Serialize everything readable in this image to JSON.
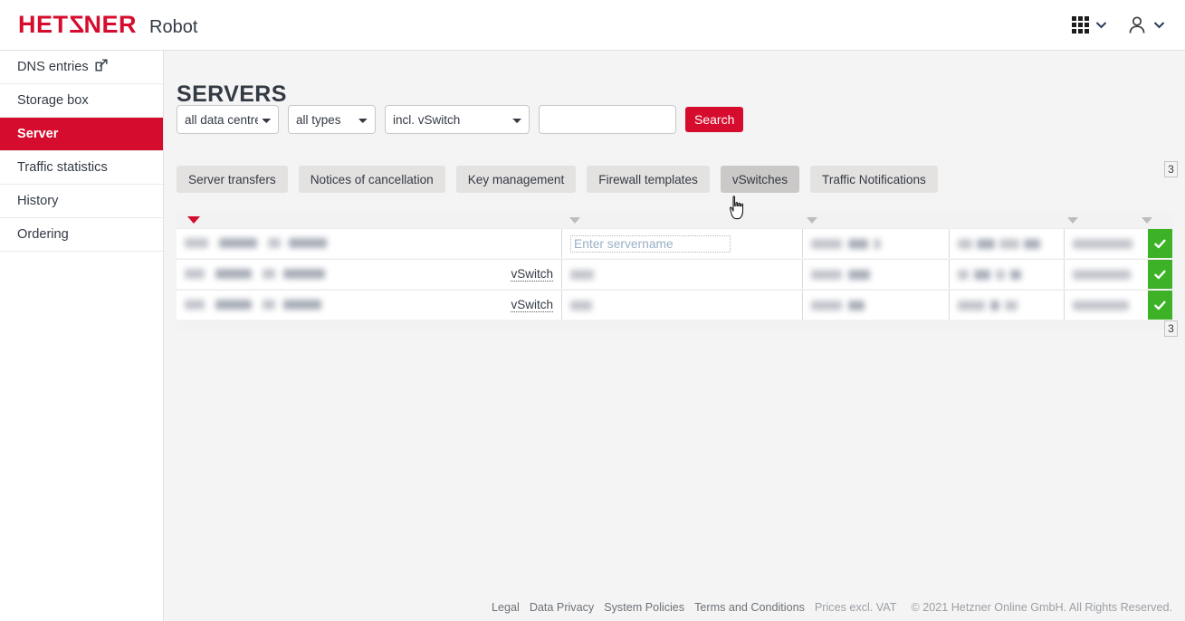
{
  "header": {
    "logo_text": "HETZNER",
    "product": "Robot",
    "apps_icon": "grid-apps-icon",
    "apps_chevron": "chevron-down-icon",
    "user_icon": "person-icon",
    "user_chevron": "chevron-down-icon"
  },
  "sidebar": {
    "items": [
      {
        "label": "DNS entries",
        "external": true,
        "active": false
      },
      {
        "label": "Storage box",
        "external": false,
        "active": false
      },
      {
        "label": "Server",
        "external": false,
        "active": true
      },
      {
        "label": "Traffic statistics",
        "external": false,
        "active": false
      },
      {
        "label": "History",
        "external": false,
        "active": false
      },
      {
        "label": "Ordering",
        "external": false,
        "active": false
      }
    ]
  },
  "main": {
    "title": "SERVERS",
    "filters": {
      "data_centre": {
        "selected": "all data centres",
        "options": [
          "all data centres"
        ]
      },
      "type": {
        "selected": "all types",
        "options": [
          "all types"
        ]
      },
      "vswitch": {
        "selected": "incl. vSwitch",
        "options": [
          "incl. vSwitch"
        ]
      },
      "search_value": "",
      "search_placeholder": "",
      "search_button": "Search"
    },
    "action_buttons": [
      {
        "label": "Server transfers",
        "hovered": false
      },
      {
        "label": "Notices of cancellation",
        "hovered": false
      },
      {
        "label": "Key management",
        "hovered": false
      },
      {
        "label": "Firewall templates",
        "hovered": false
      },
      {
        "label": "vSwitches",
        "hovered": true
      },
      {
        "label": "Traffic Notifications",
        "hovered": false
      }
    ],
    "pagination": {
      "top_badge": "3",
      "bottom_badge": "3"
    },
    "table": {
      "sort_indicator": "sort-descending-icon",
      "rows": [
        {
          "col1": "",
          "vswitch_label": "",
          "servername_value": "",
          "servername_placeholder": "Enter servername",
          "col3": "",
          "col4": "",
          "col5": "",
          "status": "check-icon"
        },
        {
          "col1": "",
          "vswitch_label": "vSwitch",
          "servername_value": "",
          "servername_placeholder": "",
          "col3": "",
          "col4": "",
          "col5": "",
          "status": "check-icon"
        },
        {
          "col1": "",
          "vswitch_label": "vSwitch",
          "servername_value": "",
          "servername_placeholder": "",
          "col3": "",
          "col4": "",
          "col5": "",
          "status": "check-icon"
        }
      ]
    }
  },
  "footer": {
    "links": [
      "Legal",
      "Data Privacy",
      "System Policies",
      "Terms and Conditions"
    ],
    "vat_note": "Prices excl. VAT",
    "copyright": "© 2021 Hetzner Online GmbH. All Rights Reserved."
  },
  "colors": {
    "brand_red": "#d50c2d",
    "status_green": "#3eb227",
    "text_dark": "#333a44",
    "content_bg": "#f4f4f4"
  }
}
